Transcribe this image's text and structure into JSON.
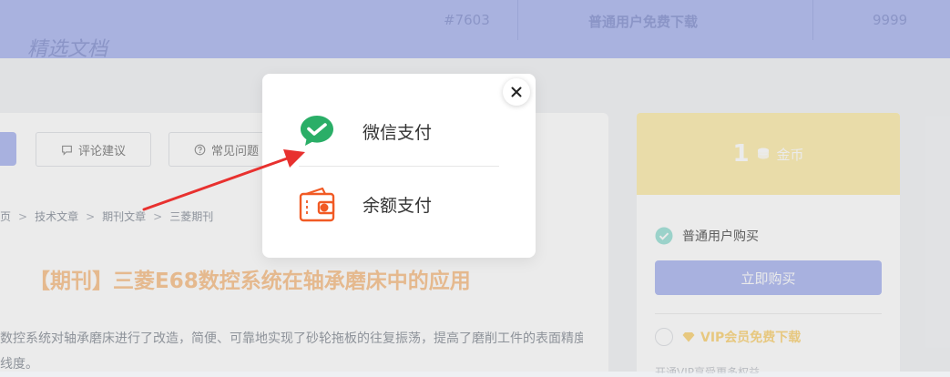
{
  "header_band": {
    "left_text": "精选文档",
    "cells": [
      "#7603",
      "普通用户免费下载",
      "9999"
    ]
  },
  "article": {
    "tabs": [
      {
        "label": "评论建议",
        "icon": "comment-icon"
      },
      {
        "label": "常见问题",
        "icon": "question-circle-icon"
      }
    ],
    "breadcrumb": [
      "页",
      "技术文章",
      "期刊文章",
      "三菱期刊"
    ],
    "title": "【期刊】三菱E68数控系统在轴承磨床中的应用",
    "paragraph": "数控系统对轴承磨床进行了改造，简便、可靠地实现了砂轮拖板的往复振荡，提高了磨削工件的表面精度。",
    "paragraph_tail": "线度。"
  },
  "sidebar": {
    "price_value": "1",
    "price_unit": "金币",
    "options": [
      {
        "label": "普通用户购买",
        "selected": true
      },
      {
        "label": "VIP会员免费下载",
        "selected": false
      }
    ],
    "buy_button": "立即购买",
    "faint_note": "开通VIP享受更多权益"
  },
  "modal": {
    "options": [
      {
        "label": "微信支付",
        "icon": "wechat-pay-icon"
      },
      {
        "label": "余额支付",
        "icon": "wallet-icon"
      }
    ],
    "close_icon": "close-icon"
  },
  "colors": {
    "accent": "#b7c1f2",
    "price_bg": "#fdefb8",
    "title": "#f9c99b",
    "wechat_green": "#2aae67",
    "wallet_orange": "#f15a24",
    "arrow_red": "#e8312f"
  }
}
